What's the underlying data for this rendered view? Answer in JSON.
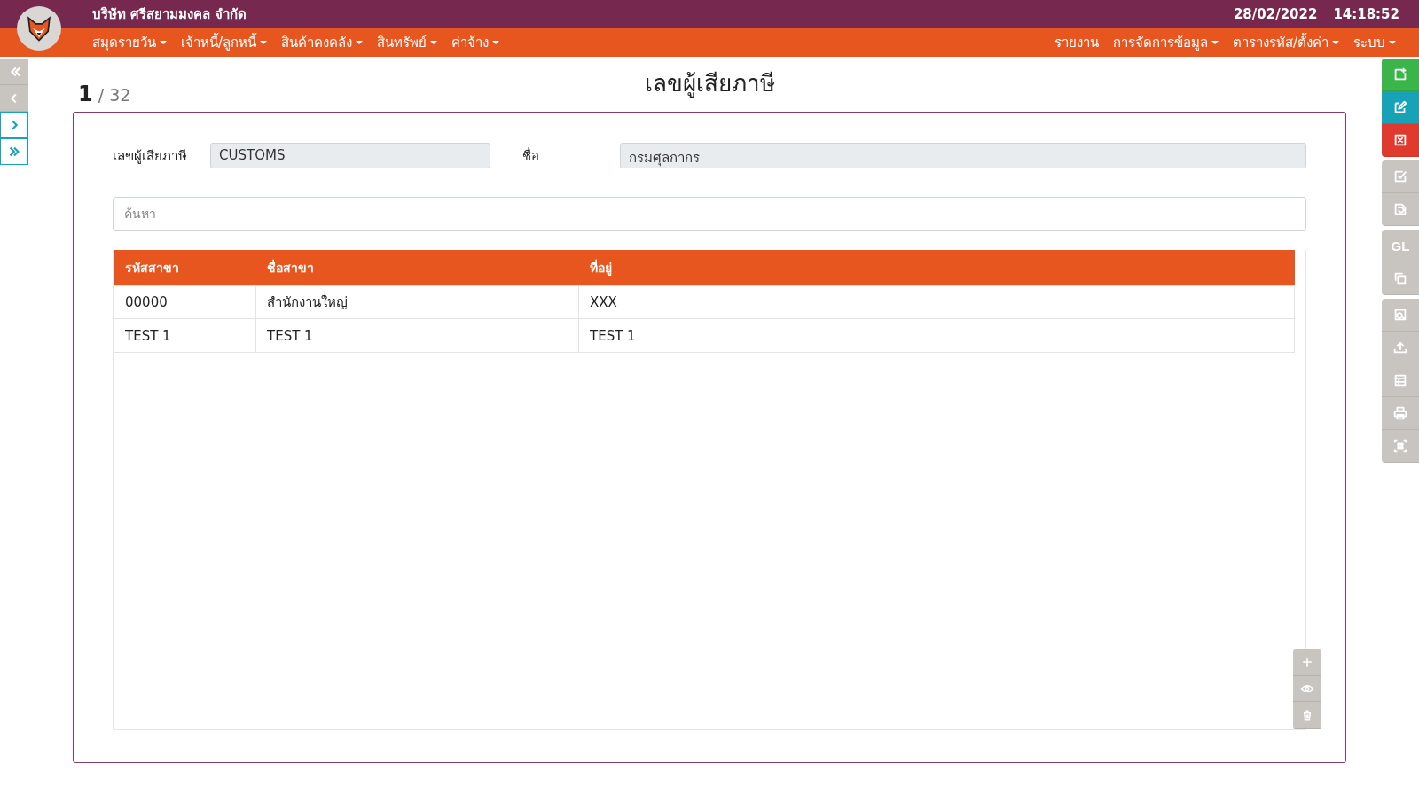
{
  "header": {
    "company": "บริษัท ศรีสยามมงคล จำกัด",
    "date": "28/02/2022",
    "time": "14:18:52"
  },
  "menu_left": [
    {
      "label": "สมุดรายวัน",
      "dropdown": true
    },
    {
      "label": "เจ้าหนี้/ลูกหนี้",
      "dropdown": true
    },
    {
      "label": "สินค้าคงคลัง",
      "dropdown": true
    },
    {
      "label": "สินทรัพย์",
      "dropdown": true
    },
    {
      "label": "ค่าจ้าง",
      "dropdown": true
    }
  ],
  "menu_right": [
    {
      "label": "รายงาน",
      "dropdown": false
    },
    {
      "label": "การจัดการข้อมูล",
      "dropdown": true
    },
    {
      "label": "ตารางรหัส/ตั้งค่า",
      "dropdown": true
    },
    {
      "label": "ระบบ",
      "dropdown": true
    }
  ],
  "record_nav": [
    {
      "kind": "first",
      "enabled": false
    },
    {
      "kind": "prev",
      "enabled": false
    },
    {
      "kind": "next",
      "enabled": true
    },
    {
      "kind": "last",
      "enabled": true
    }
  ],
  "record": {
    "current": "1",
    "separator": "/",
    "total": "32"
  },
  "page_title": "เลขผู้เสียภาษี",
  "form": {
    "tax_id_label": "เลขผู้เสียภาษี",
    "tax_id_value": "CUSTOMS",
    "name_label": "ชื่อ",
    "name_value": "กรมศุลกากร"
  },
  "search": {
    "placeholder": "ค้นหา"
  },
  "table": {
    "columns": [
      "รหัสสาขา",
      "ชื่อสาขา",
      "ที่อยู่"
    ],
    "rows": [
      [
        "00000",
        "สำนักงานใหญ่",
        "XXX"
      ],
      [
        "TEST 1",
        "TEST 1",
        "TEST 1"
      ]
    ]
  },
  "row_actions": [
    {
      "kind": "add"
    },
    {
      "kind": "view"
    },
    {
      "kind": "delete"
    }
  ],
  "toolbar": [
    [
      {
        "kind": "add",
        "color": "#3bb54a"
      },
      {
        "kind": "edit",
        "color": "#17a2b8"
      },
      {
        "kind": "delete",
        "color": "#e03a2e"
      }
    ],
    [
      {
        "kind": "check",
        "color": "#c8c5c0"
      },
      {
        "kind": "undo",
        "color": "#c8c5c0"
      }
    ],
    [
      {
        "kind": "text",
        "label": "GL",
        "color": "#c8c5c0"
      },
      {
        "kind": "copy",
        "color": "#c8c5c0"
      }
    ],
    [
      {
        "kind": "search",
        "color": "#c8c5c0"
      },
      {
        "kind": "upload",
        "color": "#c8c5c0"
      },
      {
        "kind": "table",
        "color": "#c8c5c0"
      },
      {
        "kind": "print",
        "color": "#c8c5c0"
      },
      {
        "kind": "scan",
        "color": "#c8c5c0"
      }
    ]
  ]
}
